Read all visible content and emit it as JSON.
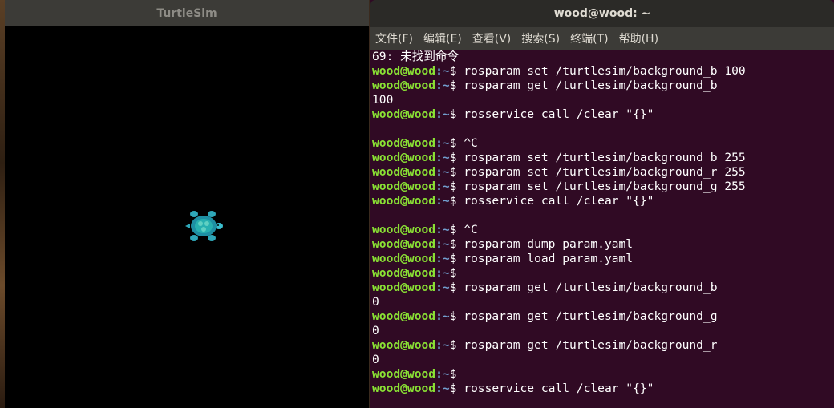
{
  "turtlesim": {
    "title": "TurtleSim"
  },
  "terminal": {
    "title": "wood@wood: ~",
    "menu": [
      "文件(F)",
      "编辑(E)",
      "查看(V)",
      "搜索(S)",
      "终端(T)",
      "帮助(H)"
    ],
    "lines": [
      {
        "kind": "output",
        "text": "69: 未找到命令"
      },
      {
        "kind": "cmd",
        "user": "wood@wood",
        "path": ":~",
        "text": "$ rosparam set /turtlesim/background_b 100"
      },
      {
        "kind": "cmd",
        "user": "wood@wood",
        "path": ":~",
        "text": "$ rosparam get /turtlesim/background_b"
      },
      {
        "kind": "output",
        "text": "100"
      },
      {
        "kind": "cmd",
        "user": "wood@wood",
        "path": ":~",
        "text": "$ rosservice call /clear \"{}\""
      },
      {
        "kind": "output",
        "text": ""
      },
      {
        "kind": "cmd",
        "user": "wood@wood",
        "path": ":~",
        "text": "$ ^C"
      },
      {
        "kind": "cmd",
        "user": "wood@wood",
        "path": ":~",
        "text": "$ rosparam set /turtlesim/background_b 255"
      },
      {
        "kind": "cmd",
        "user": "wood@wood",
        "path": ":~",
        "text": "$ rosparam set /turtlesim/background_r 255"
      },
      {
        "kind": "cmd",
        "user": "wood@wood",
        "path": ":~",
        "text": "$ rosparam set /turtlesim/background_g 255"
      },
      {
        "kind": "cmd",
        "user": "wood@wood",
        "path": ":~",
        "text": "$ rosservice call /clear \"{}\""
      },
      {
        "kind": "output",
        "text": ""
      },
      {
        "kind": "cmd",
        "user": "wood@wood",
        "path": ":~",
        "text": "$ ^C"
      },
      {
        "kind": "cmd",
        "user": "wood@wood",
        "path": ":~",
        "text": "$ rosparam dump param.yaml"
      },
      {
        "kind": "cmd",
        "user": "wood@wood",
        "path": ":~",
        "text": "$ rosparam load param.yaml"
      },
      {
        "kind": "cmd",
        "user": "wood@wood",
        "path": ":~",
        "text": "$"
      },
      {
        "kind": "cmd",
        "user": "wood@wood",
        "path": ":~",
        "text": "$ rosparam get /turtlesim/background_b"
      },
      {
        "kind": "output",
        "text": "0"
      },
      {
        "kind": "cmd",
        "user": "wood@wood",
        "path": ":~",
        "text": "$ rosparam get /turtlesim/background_g"
      },
      {
        "kind": "output",
        "text": "0"
      },
      {
        "kind": "cmd",
        "user": "wood@wood",
        "path": ":~",
        "text": "$ rosparam get /turtlesim/background_r"
      },
      {
        "kind": "output",
        "text": "0"
      },
      {
        "kind": "cmd",
        "user": "wood@wood",
        "path": ":~",
        "text": "$"
      },
      {
        "kind": "cmd",
        "user": "wood@wood",
        "path": ":~",
        "text": "$ rosservice call /clear \"{}\""
      }
    ]
  },
  "colors": {
    "terminal_bg": "#300a24",
    "prompt_user": "#8ae234",
    "prompt_path": "#729fcf",
    "turtle_bg": "#000000"
  },
  "icons": {
    "turtle": "turtle-icon"
  }
}
